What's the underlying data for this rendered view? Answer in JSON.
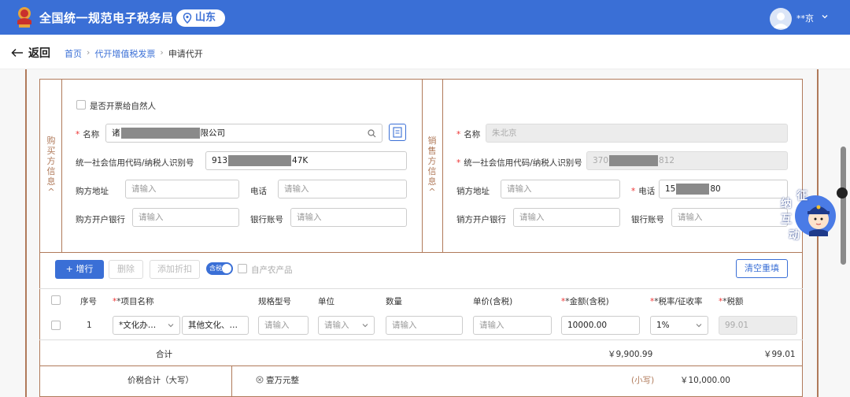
{
  "header": {
    "app_title": "全国统一规范电子税务局",
    "region": "山东",
    "user_name": "**京",
    "colors": {
      "brand": "#3a6fd6",
      "accent_border": "#b07a5a",
      "required": "#e33333"
    }
  },
  "nav": {
    "back_label": "返回",
    "breadcrumb": [
      "首页",
      "代开增值税发票",
      "申请代开"
    ]
  },
  "buyer": {
    "section_label": [
      "购",
      "买",
      "方",
      "信",
      "息"
    ],
    "natural_person_checkbox": "是否开票给自然人",
    "name_label": "名称",
    "name_prefix": "诸",
    "name_suffix": "限公司",
    "taxid_label": "统一社会信用代码/纳税人识别号",
    "taxid_prefix": "913",
    "taxid_suffix": "47K",
    "address_label": "购方地址",
    "address_placeholder": "请输入",
    "phone_label": "电话",
    "phone_placeholder": "请输入",
    "bank_label": "购方开户银行",
    "bank_placeholder": "请输入",
    "account_label": "银行账号",
    "account_placeholder": "请输入"
  },
  "seller": {
    "section_label": [
      "销",
      "售",
      "方",
      "信",
      "息"
    ],
    "name_label": "名称",
    "name_value": "朱北京",
    "taxid_label": "统一社会信用代码/纳税人识别号",
    "taxid_prefix": "370",
    "taxid_suffix": "812",
    "address_label": "销方地址",
    "address_placeholder": "请输入",
    "phone_label": "电话",
    "phone_prefix": "15",
    "phone_suffix": "80",
    "bank_label": "销方开户银行",
    "bank_placeholder": "请输入",
    "account_label": "银行账号",
    "account_placeholder": "请输入"
  },
  "mascot_text": [
    "征",
    "纳",
    "互",
    "动"
  ],
  "toolbar": {
    "add_row": "+ 增行",
    "delete": "删除",
    "add_discount": "添加折扣",
    "tax_included_toggle": "含税",
    "self_produced": "自产农产品",
    "reset": "清空重填"
  },
  "table": {
    "headers": {
      "index": "序号",
      "item_name": "*项目名称",
      "spec": "规格型号",
      "unit": "单位",
      "quantity": "数量",
      "unit_price": "单价(含税)",
      "amount": "*金额(含税)",
      "rate": "*税率/征收率",
      "tax": "*税额"
    },
    "rows": [
      {
        "index": "1",
        "item_category": "*文化办…",
        "item_detail": "其他文化、…",
        "spec_placeholder": "请输入",
        "unit_placeholder": "请输入",
        "quantity_placeholder": "请输入",
        "price_placeholder": "请输入",
        "amount": "10000.00",
        "rate": "1%",
        "tax": "99.01"
      }
    ],
    "total_label": "合计",
    "total_amount": "￥9,900.99",
    "total_tax": "￥99.01",
    "grand_label": "价税合计（大写）",
    "grand_upper": "壹万元整",
    "small_label": "(小写)",
    "grand_lower": "￥10,000.00"
  }
}
